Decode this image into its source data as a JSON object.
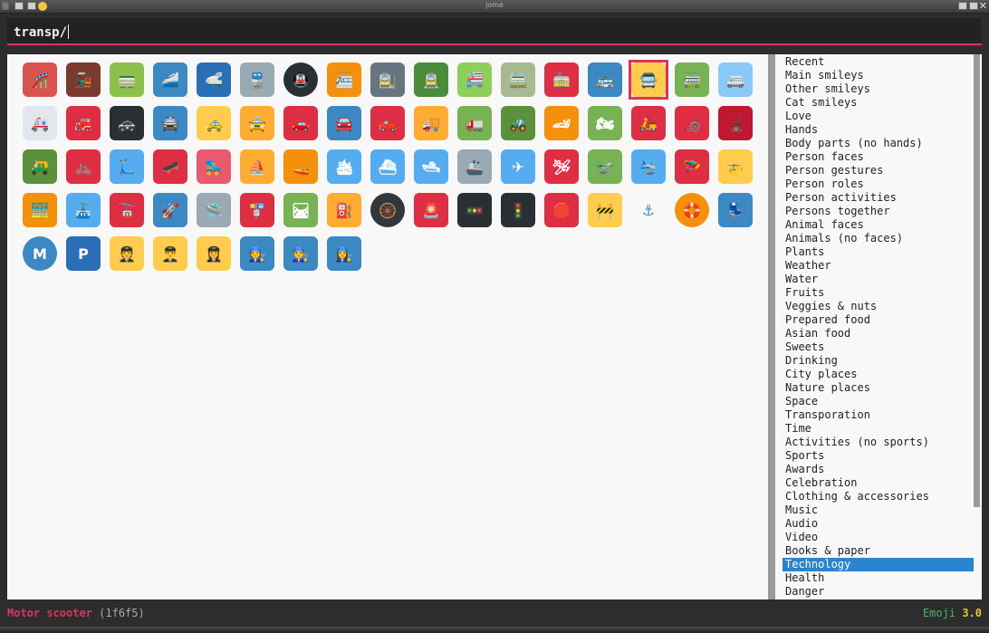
{
  "window": {
    "title": "jome"
  },
  "search": {
    "query": "transp/"
  },
  "selected_index": 14,
  "emojis": [
    {
      "name": "roller-coaster-icon",
      "color": "#d9534f",
      "glyph": "🎢"
    },
    {
      "name": "locomotive-icon",
      "color": "#7a3b2e",
      "glyph": "🚂"
    },
    {
      "name": "railway-car-icon",
      "color": "#8dbf4b",
      "glyph": "🚃"
    },
    {
      "name": "high-speed-train-icon",
      "color": "#3b88c3",
      "glyph": "🚄"
    },
    {
      "name": "bullet-train-icon",
      "color": "#2a6eb5",
      "glyph": "🚅"
    },
    {
      "name": "train-icon",
      "color": "#99aab5",
      "glyph": "🚆"
    },
    {
      "name": "metro-icon",
      "color": "#292f33",
      "glyph": "🚇",
      "round": true
    },
    {
      "name": "light-rail-icon",
      "color": "#f4900c",
      "glyph": "🚈"
    },
    {
      "name": "station-icon",
      "color": "#66757f",
      "glyph": "🚉"
    },
    {
      "name": "tram-icon",
      "color": "#4a8c3c",
      "glyph": "🚊"
    },
    {
      "name": "monorail-icon",
      "color": "#8ccf5b",
      "glyph": "🚝"
    },
    {
      "name": "mountain-railway-icon",
      "color": "#a8b88f",
      "glyph": "🚞"
    },
    {
      "name": "tram-car-icon",
      "color": "#dd2e44",
      "glyph": "🚋"
    },
    {
      "name": "bus-icon",
      "color": "#3b88c3",
      "glyph": "🚌"
    },
    {
      "name": "oncoming-bus-icon",
      "color": "#ffcc4d",
      "glyph": "🚍"
    },
    {
      "name": "trolleybus-icon",
      "color": "#77b255",
      "glyph": "🚎"
    },
    {
      "name": "minibus-icon",
      "color": "#88c9f9",
      "glyph": "🚐"
    },
    {
      "name": "ambulance-icon",
      "color": "#e1e8ed",
      "glyph": "🚑"
    },
    {
      "name": "fire-engine-icon",
      "color": "#dd2e44",
      "glyph": "🚒"
    },
    {
      "name": "police-car-icon",
      "color": "#292f33",
      "glyph": "🚓"
    },
    {
      "name": "oncoming-police-car-icon",
      "color": "#3b88c3",
      "glyph": "🚔"
    },
    {
      "name": "taxi-icon",
      "color": "#ffcc4d",
      "glyph": "🚕"
    },
    {
      "name": "oncoming-taxi-icon",
      "color": "#ffac33",
      "glyph": "🚖"
    },
    {
      "name": "automobile-icon",
      "color": "#dd2e44",
      "glyph": "🚗"
    },
    {
      "name": "oncoming-automobile-icon",
      "color": "#3b88c3",
      "glyph": "🚘"
    },
    {
      "name": "pickup-truck-icon",
      "color": "#dd2e44",
      "glyph": "🛻"
    },
    {
      "name": "delivery-truck-icon",
      "color": "#ffac33",
      "glyph": "🚚"
    },
    {
      "name": "articulated-lorry-icon",
      "color": "#77b255",
      "glyph": "🚛"
    },
    {
      "name": "tractor-icon",
      "color": "#5c913b",
      "glyph": "🚜"
    },
    {
      "name": "racing-car-icon",
      "color": "#f4900c",
      "glyph": "🏎"
    },
    {
      "name": "motorcycle-icon",
      "color": "#77b255",
      "glyph": "🏍"
    },
    {
      "name": "motor-scooter-icon",
      "color": "#dd2e44",
      "glyph": "🛵"
    },
    {
      "name": "manual-wheelchair-icon",
      "color": "#dd2e44",
      "glyph": "🦽"
    },
    {
      "name": "motorized-wheelchair-icon",
      "color": "#be1931",
      "glyph": "🦼"
    },
    {
      "name": "auto-rickshaw-icon",
      "color": "#5c913b",
      "glyph": "🛺"
    },
    {
      "name": "bicycle-icon",
      "color": "#dd2e44",
      "glyph": "🚲"
    },
    {
      "name": "kick-scooter-icon",
      "color": "#55acee",
      "glyph": "🛴"
    },
    {
      "name": "skateboard-icon",
      "color": "#dd2e44",
      "glyph": "🛹"
    },
    {
      "name": "roller-skate-icon",
      "color": "#ea596e",
      "glyph": "🛼"
    },
    {
      "name": "sailboat-icon",
      "color": "#ffac33",
      "glyph": "⛵"
    },
    {
      "name": "speedboat-icon",
      "color": "#f4900c",
      "glyph": "🚤"
    },
    {
      "name": "passenger-ship-icon",
      "color": "#55acee",
      "glyph": "🛳"
    },
    {
      "name": "ferry-icon",
      "color": "#55acee",
      "glyph": "⛴"
    },
    {
      "name": "motor-boat-icon",
      "color": "#55acee",
      "glyph": "🛥"
    },
    {
      "name": "ship-icon",
      "color": "#99aab5",
      "glyph": "🚢"
    },
    {
      "name": "airplane-icon",
      "color": "#55acee",
      "glyph": "✈"
    },
    {
      "name": "small-airplane-icon",
      "color": "#dd2e44",
      "glyph": "🛩"
    },
    {
      "name": "airplane-departure-icon",
      "color": "#77b255",
      "glyph": "🛫"
    },
    {
      "name": "airplane-arrival-icon",
      "color": "#55acee",
      "glyph": "🛬"
    },
    {
      "name": "parachute-icon",
      "color": "#dd2e44",
      "glyph": "🪂"
    },
    {
      "name": "helicopter-icon",
      "color": "#ffcc4d",
      "glyph": "🚁"
    },
    {
      "name": "suspension-railway-icon",
      "color": "#f4900c",
      "glyph": "🚟"
    },
    {
      "name": "mountain-cableway-icon",
      "color": "#55acee",
      "glyph": "🚠"
    },
    {
      "name": "aerial-tramway-icon",
      "color": "#dd2e44",
      "glyph": "🚡"
    },
    {
      "name": "rocket-icon",
      "color": "#3b88c3",
      "glyph": "🚀"
    },
    {
      "name": "flying-saucer-icon",
      "color": "#99aab5",
      "glyph": "🛸"
    },
    {
      "name": "bus-stop-icon",
      "color": "#dd2e44",
      "glyph": "🚏"
    },
    {
      "name": "railway-track-icon",
      "color": "#77b255",
      "glyph": "🛤"
    },
    {
      "name": "fuel-pump-icon",
      "color": "#ffac33",
      "glyph": "⛽"
    },
    {
      "name": "wheel-icon",
      "color": "#31373d",
      "glyph": "🛞",
      "round": true
    },
    {
      "name": "police-car-light-icon",
      "color": "#dd2e44",
      "glyph": "🚨"
    },
    {
      "name": "horizontal-traffic-light-icon",
      "color": "#292f33",
      "glyph": "🚥"
    },
    {
      "name": "vertical-traffic-light-icon",
      "color": "#292f33",
      "glyph": "🚦"
    },
    {
      "name": "stop-sign-icon",
      "color": "#dd2e44",
      "glyph": "🛑"
    },
    {
      "name": "construction-icon",
      "color": "#ffcc4d",
      "glyph": "🚧"
    },
    {
      "name": "anchor-icon",
      "color": "#3b88c3",
      "glyph": "⚓",
      "plain": true
    },
    {
      "name": "ring-buoy-icon",
      "color": "#f4900c",
      "glyph": "🛟",
      "round": true
    },
    {
      "name": "seat-icon",
      "color": "#3b88c3",
      "glyph": "💺"
    },
    {
      "name": "metro-m-sign-icon",
      "color": "#3b88c3",
      "glyph": "M",
      "round": true
    },
    {
      "name": "parking-sign-icon",
      "color": "#2a6eb5",
      "glyph": "P"
    },
    {
      "name": "pilot-icon",
      "color": "#ffcc4d",
      "glyph": "🧑‍✈️"
    },
    {
      "name": "man-pilot-icon",
      "color": "#ffcc4d",
      "glyph": "👨‍✈️"
    },
    {
      "name": "woman-pilot-icon",
      "color": "#ffcc4d",
      "glyph": "👩‍✈️"
    },
    {
      "name": "mechanic-icon",
      "color": "#3b88c3",
      "glyph": "🧑‍🔧"
    },
    {
      "name": "man-mechanic-icon",
      "color": "#3b88c3",
      "glyph": "👨‍🔧"
    },
    {
      "name": "woman-mechanic-icon",
      "color": "#3b88c3",
      "glyph": "👩‍🔧"
    }
  ],
  "categories": [
    "Recent",
    "Main smileys",
    "Other smileys",
    "Cat smileys",
    "Love",
    "Hands",
    "Body parts (no hands)",
    "Person faces",
    "Person gestures",
    "Person roles",
    "Person activities",
    "Persons together",
    "Animal faces",
    "Animals (no faces)",
    "Plants",
    "Weather",
    "Water",
    "Fruits",
    "Veggies & nuts",
    "Prepared food",
    "Asian food",
    "Sweets",
    "Drinking",
    "City places",
    "Nature places",
    "Space",
    "Transporation",
    "Time",
    "Activities (no sports)",
    "Sports",
    "Awards",
    "Celebration",
    "Clothing & accessories",
    "Music",
    "Audio",
    "Video",
    "Books & paper",
    "Technology",
    "Health",
    "Danger"
  ],
  "active_category": "Technology",
  "status": {
    "emoji_name": "Motor scooter",
    "emoji_code": "(1f6f5)",
    "app_label": "Emoji",
    "app_version": "3.0"
  },
  "colors": {
    "accent": "#e0325f",
    "selection": "#2a84d0",
    "version_green": "#44b56b"
  }
}
